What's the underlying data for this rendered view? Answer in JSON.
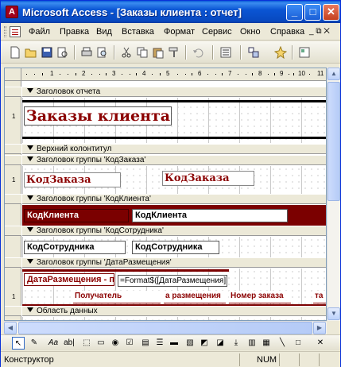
{
  "window": {
    "title": "Microsoft Access - [Заказы клиента : отчет]",
    "app_icon_glyph": "A",
    "minimize_glyph": "_",
    "maximize_glyph": "□",
    "close_glyph": "✕"
  },
  "menu": {
    "items": [
      {
        "label": "Файл"
      },
      {
        "label": "Правка"
      },
      {
        "label": "Вид"
      },
      {
        "label": "Вставка"
      },
      {
        "label": "Формат"
      },
      {
        "label": "Сервис"
      },
      {
        "label": "Окно"
      },
      {
        "label": "Справка"
      }
    ],
    "mdi_controls": "_ ⧉ ✕"
  },
  "ruler": {
    "h_labels": [
      "1",
      "2",
      "3",
      "4",
      "5",
      "6",
      "7",
      "8",
      "9",
      "10",
      "11"
    ],
    "v_labels": [
      "1",
      "1",
      "1",
      "1"
    ]
  },
  "sections": {
    "report_header": "Заголовок отчета",
    "page_header": "Верхний колонтитул",
    "group_order": "Заголовок группы 'КодЗаказа'",
    "group_client": "Заголовок группы 'КодКлиента'",
    "group_employee": "Заголовок группы 'КодСотрудника'",
    "group_date": "Заголовок группы 'ДатаРазмещения'",
    "detail": "Область данных"
  },
  "controls": {
    "report_title": "Заказы клиента",
    "order_label": "КодЗаказа",
    "order_field": "КодЗаказа",
    "client_label": "КодКлиента",
    "client_field": "КодКлиента",
    "employee_label": "КодСотрудника",
    "employee_field": "КодСотрудника",
    "date_label": "ДатаРазмещения - по",
    "date_expr": "=Format$([ДатаРазмещения];",
    "col_recipient": "Получатель",
    "col_date": "а размещения",
    "col_number": "Номер заказа",
    "col_cut": "та"
  },
  "status": {
    "mode": "Конструктор",
    "num": "NUM"
  },
  "colors": {
    "title_bar": "#0a55d4",
    "report_dark_red": "#8b0000",
    "band_fill": "#7b0000"
  }
}
